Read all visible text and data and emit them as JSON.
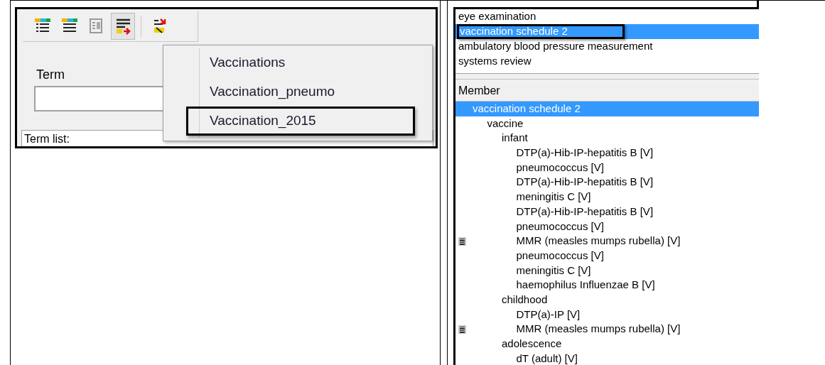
{
  "left_panel": {
    "toolbar": [
      {
        "pressed": false
      },
      {
        "pressed": false
      },
      {
        "pressed": false
      },
      {
        "pressed": true
      },
      {
        "pressed": false
      }
    ],
    "term_label": "Term",
    "term_list_label": "Term list:",
    "menu": [
      {
        "label": "Vaccinations",
        "highlighted": false
      },
      {
        "label": "Vaccination_pneumo",
        "highlighted": false
      },
      {
        "label": "Vaccination_2015",
        "highlighted": true
      }
    ]
  },
  "right_panel": {
    "list": [
      {
        "label": "eye examination",
        "selected": false
      },
      {
        "label": "vaccination schedule 2",
        "selected": true
      },
      {
        "label": "ambulatory blood pressure measurement",
        "selected": false
      },
      {
        "label": "systems review",
        "selected": false
      }
    ],
    "member_header": "Member",
    "tree": [
      {
        "label": "vaccination schedule 2",
        "selected": true,
        "flagged": false,
        "children": [
          {
            "label": "vaccine",
            "selected": false,
            "flagged": false,
            "children": [
              {
                "label": "infant",
                "selected": false,
                "flagged": false,
                "children": [
                  {
                    "label": "DTP(a)-Hib-IP-hepatitis B [V]",
                    "selected": false,
                    "flagged": false
                  },
                  {
                    "label": "pneumococcus [V]",
                    "selected": false,
                    "flagged": false
                  },
                  {
                    "label": "DTP(a)-Hib-IP-hepatitis B [V]",
                    "selected": false,
                    "flagged": false
                  },
                  {
                    "label": "meningitis C [V]",
                    "selected": false,
                    "flagged": false
                  },
                  {
                    "label": "DTP(a)-Hib-IP-hepatitis B [V]",
                    "selected": false,
                    "flagged": false
                  },
                  {
                    "label": "pneumococcus [V]",
                    "selected": false,
                    "flagged": false
                  },
                  {
                    "label": "MMR (measles mumps rubella) [V]",
                    "selected": false,
                    "flagged": true
                  },
                  {
                    "label": "pneumococcus [V]",
                    "selected": false,
                    "flagged": false
                  },
                  {
                    "label": "meningitis C [V]",
                    "selected": false,
                    "flagged": false
                  },
                  {
                    "label": "haemophilus Influenzae B [V]",
                    "selected": false,
                    "flagged": false
                  }
                ]
              },
              {
                "label": "childhood",
                "selected": false,
                "flagged": false,
                "children": [
                  {
                    "label": "DTP(a)-IP [V]",
                    "selected": false,
                    "flagged": false
                  },
                  {
                    "label": "MMR (measles mumps rubella) [V]",
                    "selected": false,
                    "flagged": true
                  }
                ]
              },
              {
                "label": "adolescence",
                "selected": false,
                "flagged": false,
                "children": [
                  {
                    "label": "dT (adult) [V]",
                    "selected": false,
                    "flagged": false
                  }
                ]
              }
            ]
          }
        ]
      }
    ]
  }
}
